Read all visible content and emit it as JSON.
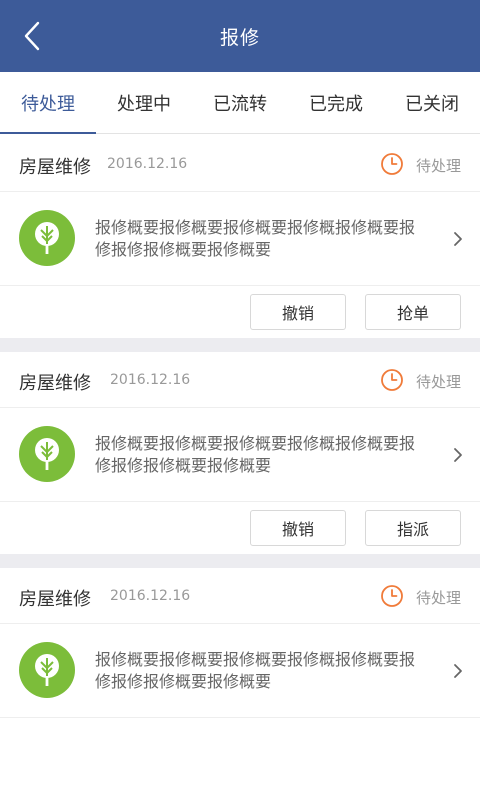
{
  "header": {
    "title": "报修"
  },
  "tabs": [
    {
      "label": "待处理",
      "active": true
    },
    {
      "label": "处理中",
      "active": false
    },
    {
      "label": "已流转",
      "active": false
    },
    {
      "label": "已完成",
      "active": false
    },
    {
      "label": "已关闭",
      "active": false
    }
  ],
  "cards": [
    {
      "title": "房屋维修",
      "date": "2016.12.16",
      "status": "待处理",
      "summary": "报修概要报修概要报修概要报修概报修概要报修报修报修概要报修概要",
      "actions": [
        "撤销",
        "抢单"
      ]
    },
    {
      "title": "房屋维修",
      "date": "2016.12.16",
      "status": "待处理",
      "summary": "报修概要报修概要报修概要报修概报修概要报修报修报修概要报修概要",
      "actions": [
        "撤销",
        "指派"
      ]
    },
    {
      "title": "房屋维修",
      "date": "2016.12.16",
      "status": "待处理",
      "summary": "报修概要报修概要报修概要报修概报修概要报修报修报修概要报修概要",
      "actions": []
    }
  ],
  "colors": {
    "primary": "#3d5b99",
    "status_orange": "#f07b3a",
    "tree_green": "#7cbd3a"
  },
  "icons": {
    "back": "chevron-left-icon",
    "clock": "clock-icon",
    "tree": "tree-icon",
    "chevron": "chevron-right-icon"
  }
}
